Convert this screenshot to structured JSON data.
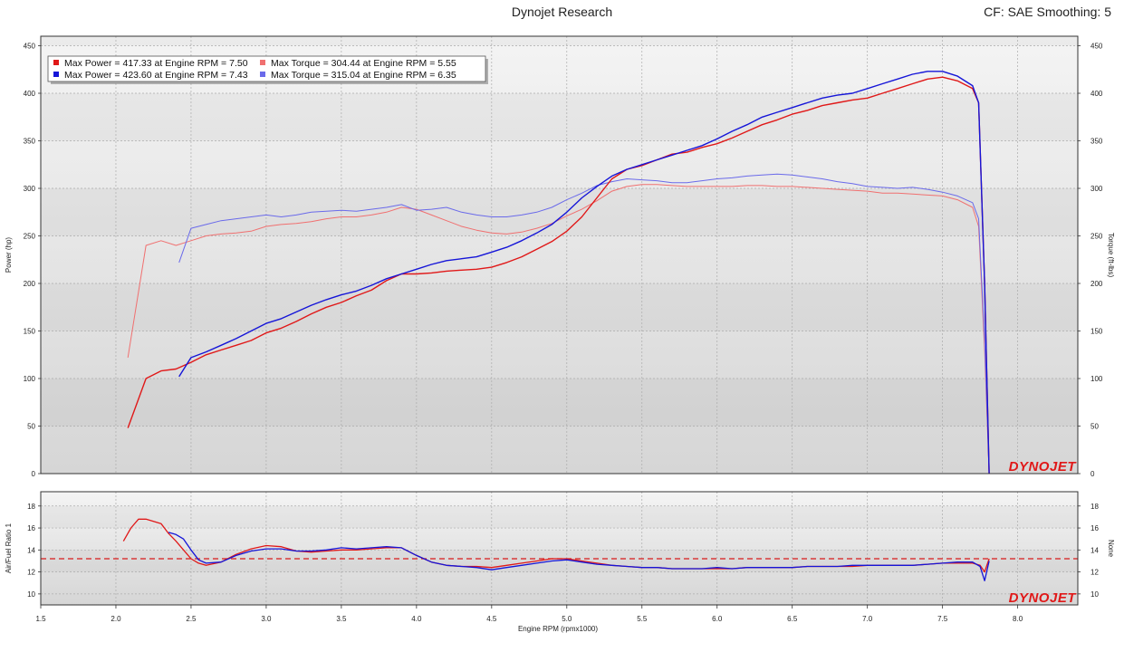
{
  "header": {
    "title": "Dynojet Research",
    "cf_label": "CF: SAE Smoothing: 5"
  },
  "logo_text": "DYNOJET",
  "colors": {
    "run1_power": "#e01818",
    "run1_torque": "#f07070",
    "run2_power": "#1515d8",
    "run2_torque": "#6a6aea",
    "afr_target": "#d81a1a"
  },
  "chart_data": [
    {
      "type": "line",
      "name": "power-torque",
      "xlabel": "Engine RPM (rpmx1000)",
      "ylabel": "Power (hp)",
      "y2label": "Torque (ft-lbs)",
      "xlim": [
        1.5,
        8.4
      ],
      "ylim": [
        0,
        460
      ],
      "xticks": [
        "1.5",
        "2.0",
        "2.5",
        "3.0",
        "3.5",
        "4.0",
        "4.5",
        "5.0",
        "5.5",
        "6.0",
        "6.5",
        "7.0",
        "7.5",
        "8.0"
      ],
      "yticks": [
        "0",
        "50",
        "100",
        "150",
        "200",
        "250",
        "300",
        "350",
        "400",
        "450"
      ],
      "grid": true,
      "legend_position": "top-left",
      "legend": [
        "Max Power = 417.33 at Engine RPM = 7.50",
        "Max Torque = 304.44 at Engine RPM = 5.55",
        "Max Power = 423.60 at Engine RPM = 7.43",
        "Max Torque = 315.04 at Engine RPM = 6.35"
      ],
      "series": [
        {
          "run": 1,
          "kind": "power",
          "x": [
            2.08,
            2.2,
            2.3,
            2.4,
            2.5,
            2.6,
            2.7,
            2.8,
            2.9,
            3.0,
            3.1,
            3.2,
            3.3,
            3.4,
            3.5,
            3.6,
            3.7,
            3.8,
            3.9,
            4.0,
            4.1,
            4.2,
            4.3,
            4.4,
            4.5,
            4.6,
            4.7,
            4.8,
            4.9,
            5.0,
            5.1,
            5.2,
            5.3,
            5.4,
            5.5,
            5.6,
            5.7,
            5.8,
            5.9,
            6.0,
            6.1,
            6.2,
            6.3,
            6.4,
            6.5,
            6.6,
            6.7,
            6.8,
            6.9,
            7.0,
            7.1,
            7.2,
            7.3,
            7.4,
            7.5,
            7.6,
            7.7,
            7.74,
            7.78,
            7.81
          ],
          "y": [
            48,
            100,
            108,
            110,
            117,
            125,
            130,
            135,
            140,
            148,
            153,
            160,
            168,
            175,
            180,
            187,
            193,
            203,
            210,
            210,
            211,
            213,
            214,
            215,
            217,
            222,
            228,
            236,
            244,
            255,
            270,
            290,
            310,
            320,
            324,
            330,
            336,
            338,
            343,
            347,
            353,
            360,
            367,
            372,
            378,
            382,
            387,
            390,
            393,
            395,
            400,
            405,
            410,
            415,
            417,
            413,
            405,
            390,
            200,
            0
          ]
        },
        {
          "run": 1,
          "kind": "torque",
          "x": [
            2.08,
            2.2,
            2.3,
            2.4,
            2.5,
            2.6,
            2.7,
            2.8,
            2.9,
            3.0,
            3.1,
            3.2,
            3.3,
            3.4,
            3.5,
            3.6,
            3.7,
            3.8,
            3.9,
            4.0,
            4.1,
            4.2,
            4.3,
            4.4,
            4.5,
            4.6,
            4.7,
            4.8,
            4.9,
            5.0,
            5.1,
            5.2,
            5.3,
            5.4,
            5.5,
            5.6,
            5.7,
            5.8,
            5.9,
            6.0,
            6.1,
            6.2,
            6.3,
            6.4,
            6.5,
            6.6,
            6.7,
            6.8,
            6.9,
            7.0,
            7.1,
            7.2,
            7.3,
            7.4,
            7.5,
            7.6,
            7.7,
            7.74,
            7.78,
            7.81
          ],
          "y": [
            122,
            240,
            245,
            240,
            245,
            250,
            252,
            253,
            255,
            260,
            262,
            263,
            265,
            268,
            270,
            270,
            272,
            275,
            280,
            278,
            272,
            266,
            260,
            256,
            253,
            252,
            254,
            258,
            263,
            271,
            278,
            287,
            297,
            302,
            304,
            304,
            303,
            302,
            302,
            302,
            302,
            303,
            303,
            302,
            302,
            301,
            300,
            299,
            298,
            297,
            295,
            295,
            294,
            293,
            292,
            288,
            280,
            260,
            130,
            0
          ]
        },
        {
          "run": 2,
          "kind": "power",
          "x": [
            2.42,
            2.5,
            2.6,
            2.7,
            2.8,
            2.9,
            3.0,
            3.1,
            3.2,
            3.3,
            3.4,
            3.5,
            3.6,
            3.7,
            3.8,
            3.9,
            4.0,
            4.1,
            4.2,
            4.3,
            4.4,
            4.5,
            4.6,
            4.7,
            4.8,
            4.9,
            5.0,
            5.1,
            5.2,
            5.3,
            5.4,
            5.5,
            5.6,
            5.7,
            5.8,
            5.9,
            6.0,
            6.1,
            6.2,
            6.3,
            6.4,
            6.5,
            6.6,
            6.7,
            6.8,
            6.9,
            7.0,
            7.1,
            7.2,
            7.3,
            7.4,
            7.5,
            7.6,
            7.7,
            7.74,
            7.78,
            7.81
          ],
          "y": [
            102,
            122,
            128,
            135,
            142,
            150,
            158,
            163,
            170,
            177,
            183,
            188,
            192,
            198,
            205,
            210,
            215,
            220,
            224,
            226,
            228,
            233,
            238,
            245,
            253,
            262,
            275,
            290,
            302,
            313,
            320,
            325,
            330,
            335,
            340,
            345,
            352,
            360,
            367,
            375,
            380,
            385,
            390,
            395,
            398,
            400,
            405,
            410,
            415,
            420,
            423,
            423,
            418,
            408,
            390,
            200,
            0
          ]
        },
        {
          "run": 2,
          "kind": "torque",
          "x": [
            2.42,
            2.5,
            2.6,
            2.7,
            2.8,
            2.9,
            3.0,
            3.1,
            3.2,
            3.3,
            3.4,
            3.5,
            3.6,
            3.7,
            3.8,
            3.9,
            4.0,
            4.1,
            4.2,
            4.3,
            4.4,
            4.5,
            4.6,
            4.7,
            4.8,
            4.9,
            5.0,
            5.1,
            5.2,
            5.3,
            5.4,
            5.5,
            5.6,
            5.7,
            5.8,
            5.9,
            6.0,
            6.1,
            6.2,
            6.3,
            6.4,
            6.5,
            6.6,
            6.7,
            6.8,
            6.9,
            7.0,
            7.1,
            7.2,
            7.3,
            7.4,
            7.5,
            7.6,
            7.7,
            7.74,
            7.78,
            7.81
          ],
          "y": [
            222,
            258,
            262,
            266,
            268,
            270,
            272,
            270,
            272,
            275,
            276,
            277,
            276,
            278,
            280,
            283,
            277,
            278,
            280,
            275,
            272,
            270,
            270,
            272,
            275,
            280,
            288,
            295,
            303,
            307,
            310,
            309,
            308,
            306,
            306,
            308,
            310,
            311,
            313,
            314,
            315,
            314,
            312,
            310,
            307,
            305,
            302,
            301,
            300,
            301,
            299,
            296,
            292,
            285,
            268,
            140,
            0
          ]
        }
      ]
    },
    {
      "type": "line",
      "name": "air-fuel",
      "ylabel": "Air/Fuel Ratio 1",
      "y2label": "None",
      "xlim": [
        1.5,
        8.4
      ],
      "ylim": [
        9,
        19.3
      ],
      "yticks": [
        "10",
        "12",
        "14",
        "16",
        "18"
      ],
      "grid": true,
      "target_afr": 13.2,
      "series": [
        {
          "run": 1,
          "x": [
            2.05,
            2.1,
            2.15,
            2.2,
            2.25,
            2.3,
            2.35,
            2.4,
            2.45,
            2.5,
            2.55,
            2.6,
            2.7,
            2.8,
            2.9,
            3.0,
            3.1,
            3.2,
            3.3,
            3.4,
            3.5,
            3.6,
            3.7,
            3.8,
            3.9,
            4.0,
            4.1,
            4.2,
            4.3,
            4.4,
            4.5,
            4.6,
            4.7,
            4.8,
            4.9,
            5.0,
            5.1,
            5.2,
            5.3,
            5.4,
            5.5,
            5.6,
            5.7,
            5.8,
            5.9,
            6.0,
            6.1,
            6.2,
            6.3,
            6.4,
            6.5,
            6.6,
            6.7,
            6.8,
            6.9,
            7.0,
            7.1,
            7.2,
            7.3,
            7.4,
            7.5,
            7.6,
            7.7,
            7.75,
            7.78,
            7.81
          ],
          "y": [
            14.8,
            16.0,
            16.8,
            16.8,
            16.6,
            16.4,
            15.5,
            14.8,
            14.0,
            13.2,
            12.8,
            12.6,
            12.9,
            13.6,
            14.1,
            14.4,
            14.3,
            13.9,
            13.8,
            13.9,
            14.0,
            14.0,
            14.1,
            14.2,
            14.2,
            13.5,
            12.9,
            12.6,
            12.5,
            12.5,
            12.4,
            12.6,
            12.8,
            13.0,
            13.2,
            13.2,
            13.0,
            12.8,
            12.6,
            12.5,
            12.4,
            12.4,
            12.3,
            12.3,
            12.3,
            12.3,
            12.3,
            12.4,
            12.4,
            12.4,
            12.4,
            12.5,
            12.5,
            12.5,
            12.5,
            12.6,
            12.6,
            12.6,
            12.6,
            12.7,
            12.8,
            12.8,
            12.8,
            12.6,
            12.0,
            13.2
          ]
        },
        {
          "run": 2,
          "x": [
            2.35,
            2.4,
            2.45,
            2.5,
            2.55,
            2.6,
            2.7,
            2.8,
            2.9,
            3.0,
            3.1,
            3.2,
            3.3,
            3.4,
            3.5,
            3.6,
            3.7,
            3.8,
            3.9,
            4.0,
            4.1,
            4.2,
            4.3,
            4.4,
            4.5,
            4.6,
            4.7,
            4.8,
            4.9,
            5.0,
            5.1,
            5.2,
            5.3,
            5.4,
            5.5,
            5.6,
            5.7,
            5.8,
            5.9,
            6.0,
            6.1,
            6.2,
            6.3,
            6.4,
            6.5,
            6.6,
            6.7,
            6.8,
            6.9,
            7.0,
            7.1,
            7.2,
            7.3,
            7.4,
            7.5,
            7.6,
            7.7,
            7.75,
            7.78,
            7.81
          ],
          "y": [
            15.6,
            15.4,
            15.0,
            14.0,
            13.1,
            12.8,
            12.9,
            13.5,
            13.9,
            14.1,
            14.1,
            13.9,
            13.9,
            14.0,
            14.2,
            14.1,
            14.2,
            14.3,
            14.2,
            13.5,
            12.9,
            12.6,
            12.5,
            12.4,
            12.2,
            12.4,
            12.6,
            12.8,
            13.0,
            13.1,
            12.9,
            12.7,
            12.6,
            12.5,
            12.4,
            12.4,
            12.3,
            12.3,
            12.3,
            12.4,
            12.3,
            12.4,
            12.4,
            12.4,
            12.4,
            12.5,
            12.5,
            12.5,
            12.6,
            12.6,
            12.6,
            12.6,
            12.6,
            12.7,
            12.8,
            12.9,
            12.9,
            12.5,
            11.2,
            13.0
          ]
        }
      ]
    }
  ]
}
